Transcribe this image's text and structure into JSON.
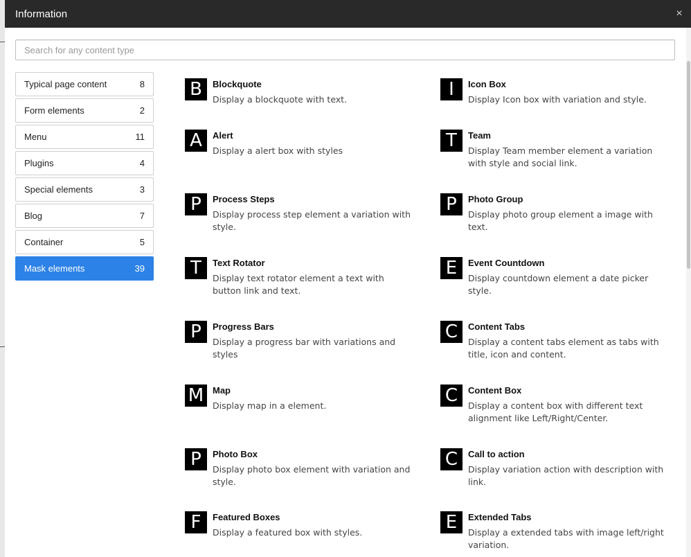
{
  "dialog": {
    "title": "Information",
    "close_glyph": "×",
    "search_placeholder": "Search for any content type"
  },
  "sidebar": {
    "items": [
      {
        "label": "Typical page content",
        "count": "8"
      },
      {
        "label": "Form elements",
        "count": "2"
      },
      {
        "label": "Menu",
        "count": "11"
      },
      {
        "label": "Plugins",
        "count": "4"
      },
      {
        "label": "Special elements",
        "count": "3"
      },
      {
        "label": "Blog",
        "count": "7"
      },
      {
        "label": "Container",
        "count": "5"
      },
      {
        "label": "Mask elements",
        "count": "39"
      }
    ],
    "active": "Mask elements",
    "active_color": "#2c82e6"
  },
  "elements": {
    "left": [
      {
        "letter": "B",
        "title": "Blockquote",
        "desc": "Display a blockquote with text."
      },
      {
        "letter": "A",
        "title": "Alert",
        "desc": "Display a alert box with styles"
      },
      {
        "letter": "P",
        "title": "Process Steps",
        "desc": "Display process step element a variation with style."
      },
      {
        "letter": "T",
        "title": "Text Rotator",
        "desc": "Display text rotator element a text with button link and text."
      },
      {
        "letter": "P",
        "title": "Progress Bars",
        "desc": "Display a progress bar with variations and styles"
      },
      {
        "letter": "M",
        "title": "Map",
        "desc": "Display map in a element."
      },
      {
        "letter": "P",
        "title": "Photo Box",
        "desc": "Display photo box element with variation and style."
      },
      {
        "letter": "F",
        "title": "Featured Boxes",
        "desc": "Display a featured box with styles."
      }
    ],
    "right": [
      {
        "letter": "I",
        "title": "Icon Box",
        "desc": "Display Icon box with variation and style."
      },
      {
        "letter": "T",
        "title": "Team",
        "desc": "Display Team member element a variation with style and social link."
      },
      {
        "letter": "P",
        "title": "Photo Group",
        "desc": "Display photo group element a image with text."
      },
      {
        "letter": "E",
        "title": "Event Countdown",
        "desc": "Display countdown element a date picker style."
      },
      {
        "letter": "C",
        "title": "Content Tabs",
        "desc": "Display a content tabs element as tabs with title, icon and content."
      },
      {
        "letter": "C",
        "title": "Content Box",
        "desc": "Display a content box with different text alignment like Left/Right/Center."
      },
      {
        "letter": "C",
        "title": "Call to action",
        "desc": "Display variation action with description with link."
      },
      {
        "letter": "E",
        "title": "Extended Tabs",
        "desc": "Display a extended tabs with image left/right variation."
      }
    ]
  }
}
